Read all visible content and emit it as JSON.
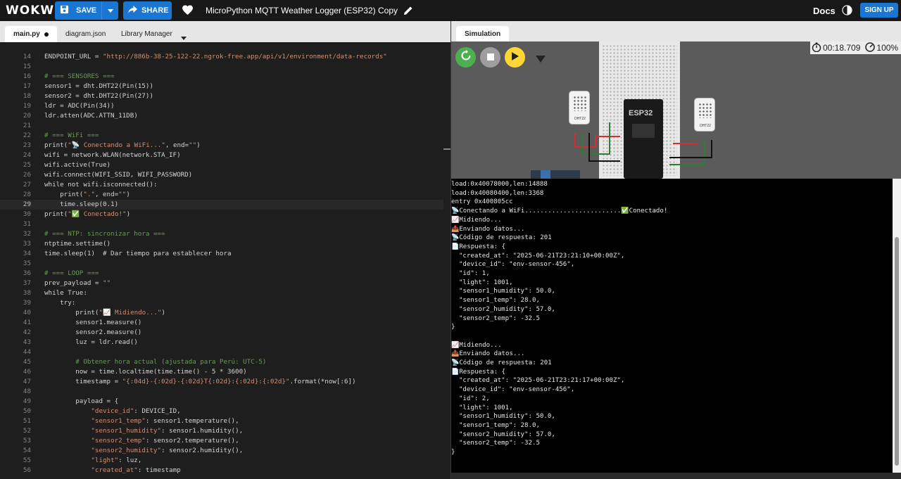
{
  "header": {
    "logo": "WOKWI",
    "save_label": "SAVE",
    "share_label": "SHARE",
    "project_title": "MicroPython MQTT Weather Logger (ESP32) Copy",
    "docs_label": "Docs",
    "signup_label": "SIGN UP"
  },
  "tabs": [
    {
      "label": "main.py"
    },
    {
      "label": "diagram.json"
    },
    {
      "label": "Library Manager"
    }
  ],
  "simulation": {
    "tab_label": "Simulation",
    "timer": "00:18.709",
    "speed": "100%",
    "chip_label": "ESP32",
    "sensor_labels": [
      "DHT22",
      "DHT22"
    ]
  },
  "editor": {
    "lines": [
      {
        "n": "14",
        "t": "ENDPOINT_URL = \"http://886b-38-25-122-22.ngrok-free.app/api/v1/environment/data-records\""
      },
      {
        "n": "15",
        "t": ""
      },
      {
        "n": "16",
        "t": "# === SENSORES ==="
      },
      {
        "n": "17",
        "t": "sensor1 = dht.DHT22(Pin(15))"
      },
      {
        "n": "18",
        "t": "sensor2 = dht.DHT22(Pin(27))"
      },
      {
        "n": "19",
        "t": "ldr = ADC(Pin(34))"
      },
      {
        "n": "20",
        "t": "ldr.atten(ADC.ATTN_11DB)"
      },
      {
        "n": "21",
        "t": ""
      },
      {
        "n": "22",
        "t": "# === WiFi ==="
      },
      {
        "n": "23",
        "t": "print(\"📡 Conectando a WiFi...\", end=\"\")"
      },
      {
        "n": "24",
        "t": "wifi = network.WLAN(network.STA_IF)"
      },
      {
        "n": "25",
        "t": "wifi.active(True)"
      },
      {
        "n": "26",
        "t": "wifi.connect(WIFI_SSID, WIFI_PASSWORD)"
      },
      {
        "n": "27",
        "t": "while not wifi.isconnected():"
      },
      {
        "n": "28",
        "t": "    print(\".\", end=\"\")"
      },
      {
        "n": "29",
        "t": "    time.sleep(0.1)"
      },
      {
        "n": "30",
        "t": "print(\"✅ Conectado!\")"
      },
      {
        "n": "31",
        "t": ""
      },
      {
        "n": "32",
        "t": "# === NTP: sincronizar hora ==="
      },
      {
        "n": "33",
        "t": "ntptime.settime()"
      },
      {
        "n": "34",
        "t": "time.sleep(1)  # Dar tiempo para establecer hora"
      },
      {
        "n": "35",
        "t": ""
      },
      {
        "n": "36",
        "t": "# === LOOP ==="
      },
      {
        "n": "37",
        "t": "prev_payload = \"\""
      },
      {
        "n": "38",
        "t": "while True:"
      },
      {
        "n": "39",
        "t": "    try:"
      },
      {
        "n": "40",
        "t": "        print(\"📈 Midiendo...\")"
      },
      {
        "n": "41",
        "t": "        sensor1.measure()"
      },
      {
        "n": "42",
        "t": "        sensor2.measure()"
      },
      {
        "n": "43",
        "t": "        luz = ldr.read()"
      },
      {
        "n": "44",
        "t": ""
      },
      {
        "n": "45",
        "t": "        # Obtener hora actual (ajustada para Perú: UTC-5)"
      },
      {
        "n": "46",
        "t": "        now = time.localtime(time.time() - 5 * 3600)"
      },
      {
        "n": "47",
        "t": "        timestamp = \"{:04d}-{:02d}-{:02d}T{:02d}:{:02d}:{:02d}\".format(*now[:6])"
      },
      {
        "n": "48",
        "t": ""
      },
      {
        "n": "49",
        "t": "        payload = {"
      },
      {
        "n": "50",
        "t": "            \"device_id\": DEVICE_ID,"
      },
      {
        "n": "51",
        "t": "            \"sensor1_temp\": sensor1.temperature(),"
      },
      {
        "n": "52",
        "t": "            \"sensor1_humidity\": sensor1.humidity(),"
      },
      {
        "n": "53",
        "t": "            \"sensor2_temp\": sensor2.temperature(),"
      },
      {
        "n": "54",
        "t": "            \"sensor2_humidity\": sensor2.humidity(),"
      },
      {
        "n": "55",
        "t": "            \"light\": luz,"
      },
      {
        "n": "56",
        "t": "            \"created_at\": timestamp"
      }
    ]
  },
  "serial": {
    "lines": [
      "load:0x40078000,len:14888",
      "load:0x40080400,len:3368",
      "entry 0x400805cc",
      "📡Conectando a WiFi.........................✅Conectado!",
      "📈Midiendo...",
      "📤Enviando datos...",
      "📡Código de respuesta: 201",
      "📄Respuesta: {",
      "  \"created_at\": \"2025-06-21T23:21:10+00:00Z\",",
      "  \"device_id\": \"env-sensor-456\",",
      "  \"id\": 1,",
      "  \"light\": 1001,",
      "  \"sensor1_humidity\": 50.0,",
      "  \"sensor1_temp\": 28.0,",
      "  \"sensor2_humidity\": 57.0,",
      "  \"sensor2_temp\": -32.5",
      "}",
      "",
      "📈Midiendo...",
      "📤Enviando datos...",
      "📡Código de respuesta: 201",
      "📄Respuesta: {",
      "  \"created_at\": \"2025-06-21T23:21:17+00:00Z\",",
      "  \"device_id\": \"env-sensor-456\",",
      "  \"id\": 2,",
      "  \"light\": 1001,",
      "  \"sensor1_humidity\": 50.0,",
      "  \"sensor1_temp\": 28.0,",
      "  \"sensor2_humidity\": 57.0,",
      "  \"sensor2_temp\": -32.5",
      "}"
    ]
  },
  "colors": {
    "accent": "#1976d2",
    "restart": "#4caf50",
    "stop": "#9e9e9e",
    "play": "#fdd835"
  }
}
